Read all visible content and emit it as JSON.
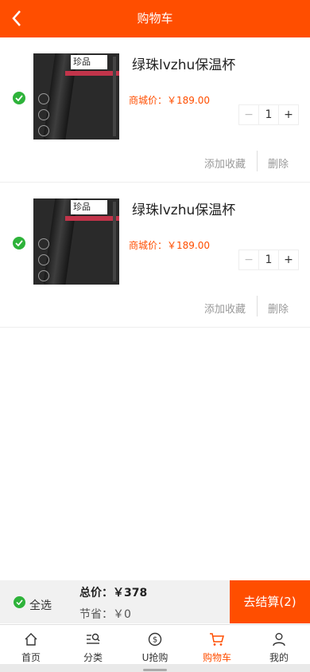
{
  "header": {
    "title": "购物车"
  },
  "items": [
    {
      "name": "绿珠lvzhu保温杯",
      "price_label": "商城价：",
      "price": "￥189.00",
      "qty": "1",
      "minus": "−",
      "plus": "+",
      "fav": "添加收藏",
      "del": "删除",
      "thumb_tag": "珍品"
    },
    {
      "name": "绿珠lvzhu保温杯",
      "price_label": "商城价：",
      "price": "￥189.00",
      "qty": "1",
      "minus": "−",
      "plus": "+",
      "fav": "添加收藏",
      "del": "删除",
      "thumb_tag": "珍品"
    }
  ],
  "checkout": {
    "select_all": "全选",
    "total": "总价：￥378",
    "save": "节省：￥0",
    "button": "去结算(2)"
  },
  "tabbar": [
    {
      "label": "首页",
      "icon": "home-icon"
    },
    {
      "label": "分类",
      "icon": "category-icon"
    },
    {
      "label": "U抢购",
      "icon": "coin-icon"
    },
    {
      "label": "购物车",
      "icon": "cart-icon",
      "active": true
    },
    {
      "label": "我的",
      "icon": "user-icon"
    }
  ],
  "colors": {
    "accent": "#ff4e00",
    "check": "#2eb33a"
  }
}
